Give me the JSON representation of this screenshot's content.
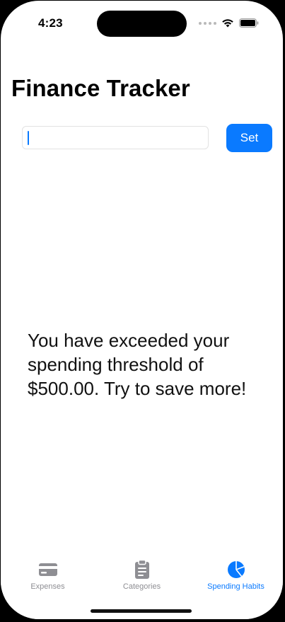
{
  "status_bar": {
    "time": "4:23"
  },
  "page": {
    "title": "Finance Tracker"
  },
  "threshold": {
    "input_value": "",
    "button_label": "Set"
  },
  "message": {
    "text": "You have exceeded your spending threshold of $500.00. Try to save more!"
  },
  "tab_bar": {
    "tabs": [
      {
        "label": "Expenses",
        "icon": "credit-card-icon",
        "active": false
      },
      {
        "label": "Categories",
        "icon": "clipboard-icon",
        "active": false
      },
      {
        "label": "Spending Habits",
        "icon": "pie-chart-icon",
        "active": true
      }
    ]
  },
  "colors": {
    "accent": "#0a7aff",
    "inactive": "#8e8e93"
  }
}
